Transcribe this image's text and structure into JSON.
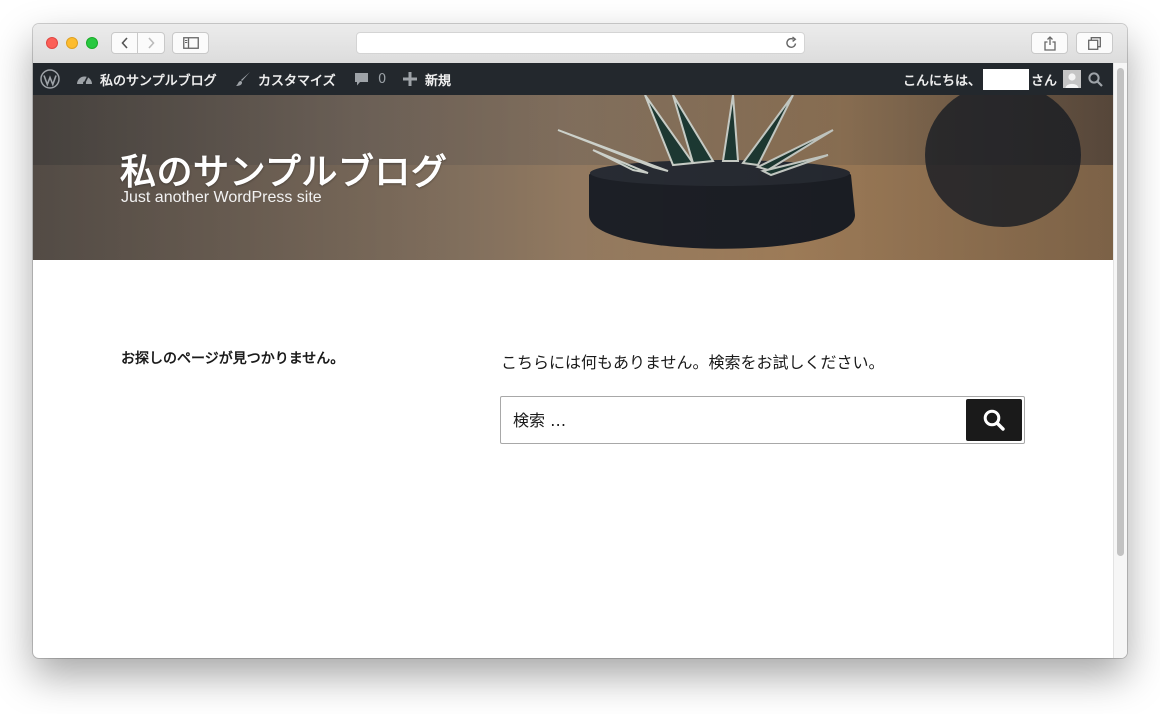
{
  "browser": {
    "address_text": "",
    "colors": {
      "close": "#fc5f57",
      "minimize": "#fdbc2e",
      "maximize": "#28c840"
    }
  },
  "adminbar": {
    "wp_logo_icon": "wordpress-logo-icon",
    "site_name": "私のサンプルブログ",
    "customize": "カスタマイズ",
    "comments_count": "0",
    "new_label": "新規",
    "greeting_prefix": "こんにちは、",
    "greeting_suffix": "さん"
  },
  "header": {
    "site_title": "私のサンプルブログ",
    "site_description": "Just another WordPress site"
  },
  "main": {
    "page_title": "お探しのページが見つかりません。",
    "message": "こちらには何もありません。検索をお試しください。",
    "search": {
      "placeholder": "検索 …",
      "value": ""
    }
  }
}
